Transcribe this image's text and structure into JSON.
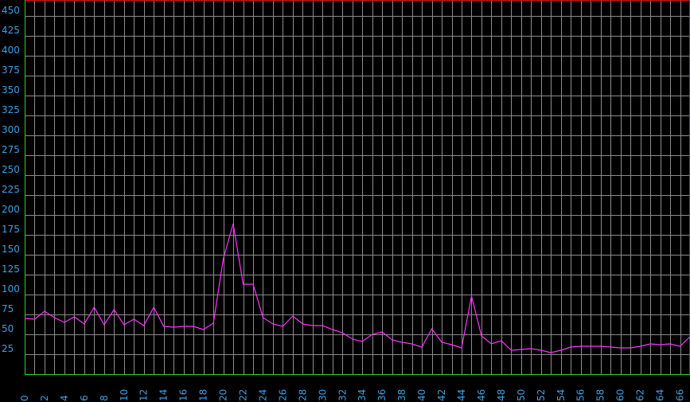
{
  "chart_data": {
    "type": "line",
    "title": "",
    "xlabel": "",
    "ylabel": "",
    "xlim": [
      0,
      67
    ],
    "ylim": [
      0,
      470
    ],
    "grid": true,
    "x_ticks": [
      0,
      2,
      4,
      6,
      8,
      10,
      12,
      14,
      16,
      18,
      20,
      22,
      24,
      26,
      28,
      30,
      32,
      34,
      36,
      38,
      40,
      42,
      44,
      46,
      48,
      50,
      52,
      54,
      56,
      58,
      60,
      62,
      64,
      66
    ],
    "y_ticks": [
      25,
      50,
      75,
      100,
      125,
      150,
      175,
      200,
      225,
      250,
      275,
      300,
      325,
      350,
      375,
      400,
      425,
      450
    ],
    "series": [
      {
        "color": "#ff33ff",
        "x": [
          0,
          1,
          2,
          3,
          4,
          5,
          6,
          7,
          8,
          9,
          10,
          11,
          12,
          13,
          14,
          15,
          16,
          17,
          18,
          19,
          20,
          21,
          22,
          23,
          24,
          25,
          26,
          27,
          28,
          29,
          30,
          31,
          32,
          33,
          34,
          35,
          36,
          37,
          38,
          39,
          40,
          41,
          42,
          43,
          44,
          45,
          46,
          47,
          48,
          49,
          50,
          51,
          52,
          53,
          54,
          55,
          56,
          57,
          58,
          59,
          60,
          61,
          62,
          63,
          64,
          65,
          66,
          67
        ],
        "y": [
          70,
          69,
          79,
          71,
          65,
          72,
          63,
          84,
          62,
          81,
          62,
          69,
          61,
          84,
          60,
          59,
          60,
          60,
          56,
          64,
          145,
          189,
          113,
          113,
          71,
          63,
          60,
          73,
          63,
          61,
          61,
          56,
          52,
          44,
          41,
          50,
          53,
          43,
          40,
          38,
          34,
          57,
          40,
          37,
          33,
          98,
          48,
          38,
          42,
          30,
          31,
          32,
          30,
          27,
          30,
          34,
          35,
          35,
          35,
          34,
          33,
          33,
          35,
          38,
          37,
          38,
          35,
          47
        ]
      }
    ]
  },
  "colors": {
    "background": "#000000",
    "grid": "#8c8c8c",
    "frame": "#e01010",
    "baseline": "#2ad12a",
    "tick_text": "#3aa0e6",
    "line": "#ff33ff"
  }
}
